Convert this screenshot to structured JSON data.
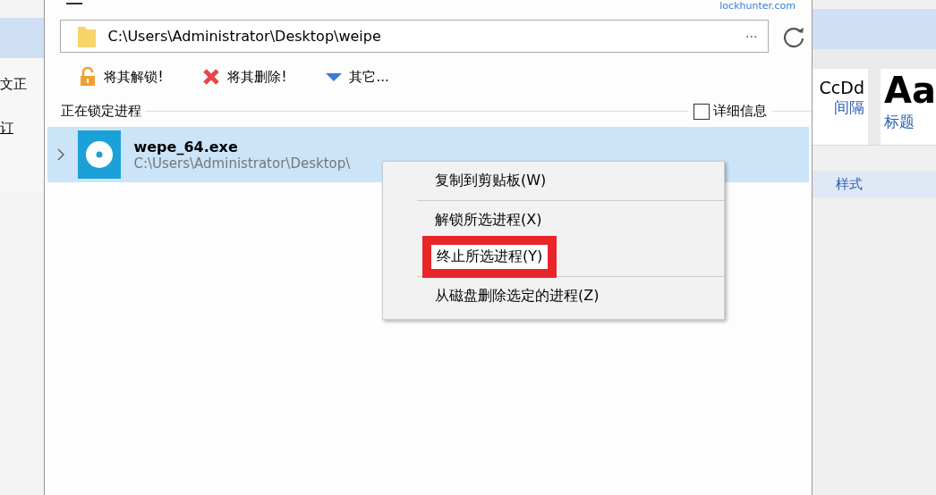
{
  "background_left": {
    "texts": [
      "文正",
      "订"
    ]
  },
  "background_right": {
    "styles": [
      {
        "sample": "CcDd",
        "label": "间隔"
      },
      {
        "sample": "Aa",
        "label": "标题"
      }
    ],
    "group_label": "样式"
  },
  "window": {
    "link": "lockhunter.com",
    "path": {
      "value": "C:\\Users\\Administrator\\Desktop\\weipe",
      "more": "···"
    },
    "toolbar": [
      {
        "kind": "unlock",
        "label": "将其解锁!"
      },
      {
        "kind": "delete",
        "label": "将其删除!"
      },
      {
        "kind": "other",
        "label": "其它..."
      }
    ],
    "section_title": "正在锁定进程",
    "details": {
      "label": "详细信息",
      "checked": false
    },
    "processes": [
      {
        "name": "wepe_64.exe",
        "path": "C:\\Users\\Administrator\\Desktop\\",
        "selected": true,
        "expanded": false
      }
    ]
  },
  "context_menu": {
    "items": [
      {
        "label": "复制到剪贴板(W)",
        "highlighted": false,
        "separator_after": true
      },
      {
        "label": "解锁所选进程(X)",
        "highlighted": false,
        "separator_after": false
      },
      {
        "label": "终止所选进程(Y)",
        "highlighted": true,
        "separator_after": true
      },
      {
        "label": "从磁盘删除选定的进程(Z)",
        "highlighted": false,
        "separator_after": false
      }
    ]
  }
}
